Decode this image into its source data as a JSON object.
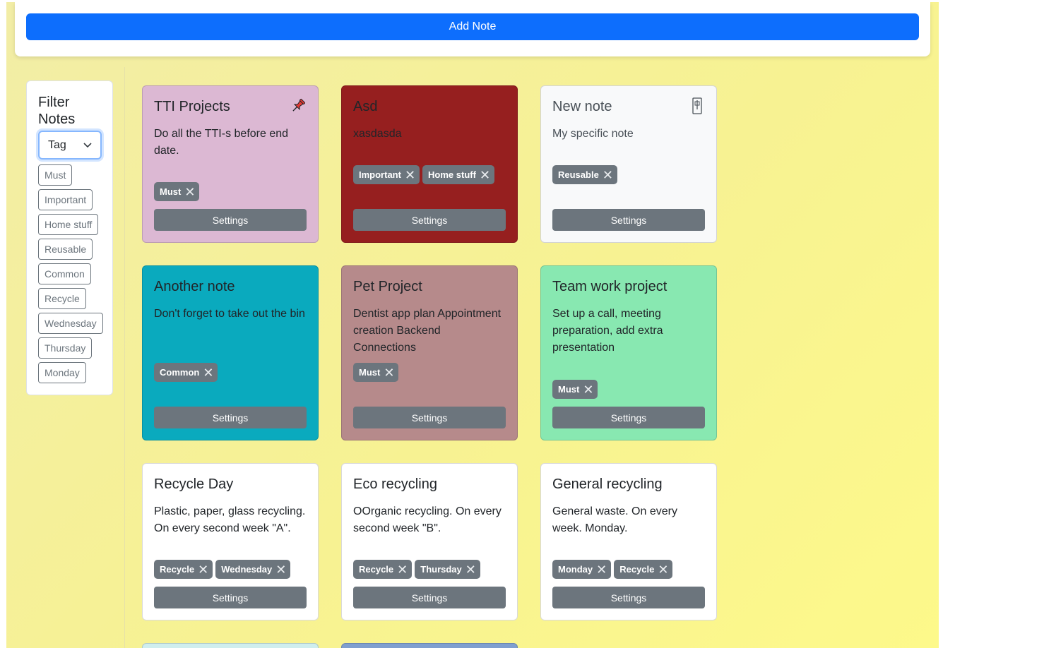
{
  "header": {
    "add_label": "Add Note"
  },
  "filter": {
    "title": "Filter Notes",
    "select_value": "Tag",
    "tags": [
      "Must",
      "Important",
      "Home stuff",
      "Reusable",
      "Common",
      "Recycle",
      "Wednesday",
      "Thursday",
      "Monday"
    ]
  },
  "notes": [
    {
      "title": "TTI Projects",
      "body": "Do all the TTI-s before end date.",
      "tags": [
        "Must"
      ],
      "settings": "Settings",
      "bg": "#dcb8d3",
      "text_color": "#212529",
      "pin": "pinned-red"
    },
    {
      "title": "Asd",
      "body": "xasdasda",
      "tags": [
        "Important",
        "Home stuff"
      ],
      "settings": "Settings",
      "bg": "#961f1f",
      "text_color": "#212529",
      "pin": "none"
    },
    {
      "title": "New note",
      "body": "My specific note",
      "tags": [
        "Reusable"
      ],
      "settings": "Settings",
      "bg": "#f8f9fa",
      "text_color": "#495057",
      "pin": "unpinned"
    },
    {
      "title": "Another note",
      "body": "Don't forget to take out the bin",
      "tags": [
        "Common"
      ],
      "settings": "Settings",
      "bg": "#0aaabe",
      "text_color": "#212529",
      "pin": "none"
    },
    {
      "title": "Pet Project",
      "body": "Dentist app plan Appointment creation Backend Connections",
      "tags": [
        "Must"
      ],
      "settings": "Settings",
      "bg": "#b68a8b",
      "text_color": "#212529",
      "pin": "none"
    },
    {
      "title": "Team work project",
      "body": "Set up a call, meeting preparation, add extra presentation",
      "tags": [
        "Must"
      ],
      "settings": "Settings",
      "bg": "#88e8b1",
      "text_color": "#212529",
      "pin": "none"
    },
    {
      "title": "Recycle Day",
      "body": "Plastic, paper, glass recycling. On every second week \"A\".",
      "tags": [
        "Recycle",
        "Wednesday"
      ],
      "settings": "Settings",
      "bg": "#ffffff",
      "text_color": "#212529",
      "pin": "none"
    },
    {
      "title": "Eco recycling",
      "body": "OOrganic recycling. On every second week \"B\".",
      "tags": [
        "Recycle",
        "Thursday"
      ],
      "settings": "Settings",
      "bg": "#ffffff",
      "text_color": "#212529",
      "pin": "none"
    },
    {
      "title": "General recycling",
      "body": "General waste. On every week. Monday.",
      "tags": [
        "Monday",
        "Recycle"
      ],
      "settings": "Settings",
      "bg": "#ffffff",
      "text_color": "#212529",
      "pin": "none"
    }
  ],
  "partial_notes_bg": [
    "#cfeeee",
    "#7f9fcf"
  ]
}
